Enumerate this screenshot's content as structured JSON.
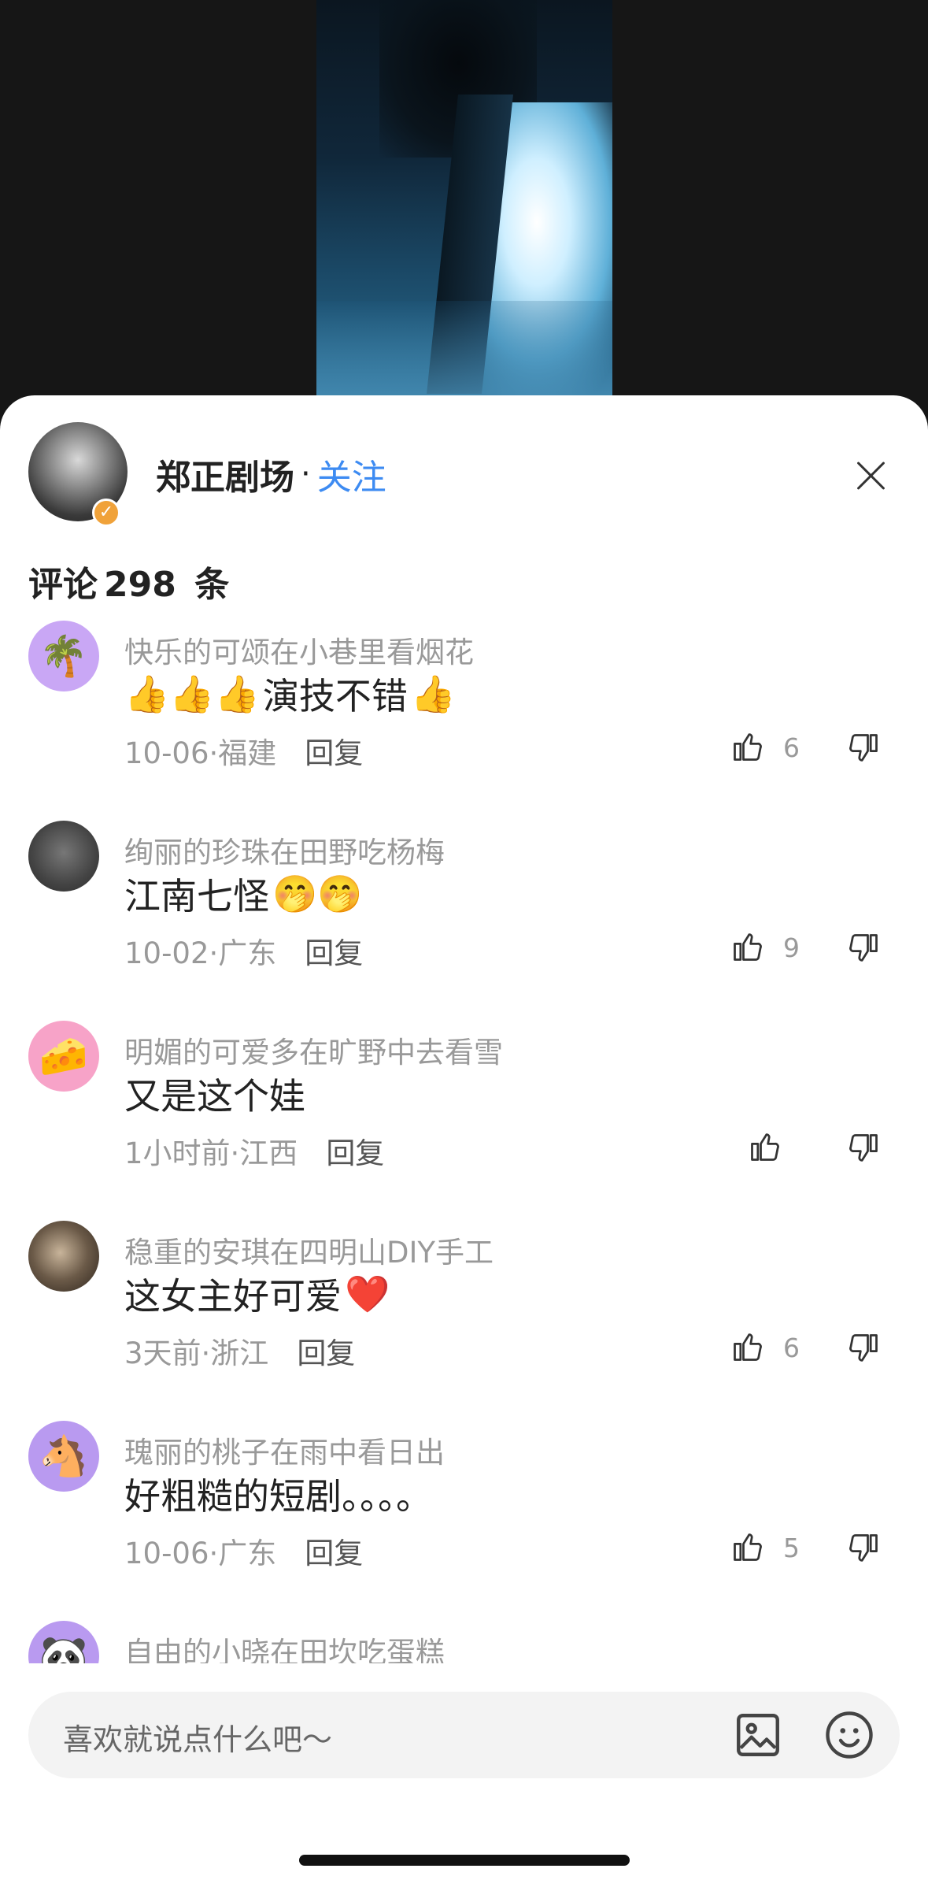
{
  "author": {
    "name": "郑正剧场",
    "separator": "·",
    "follow_label": "关注",
    "verified_mark": "✓"
  },
  "comments_header": {
    "label": "评论",
    "count": "298",
    "unit": "条"
  },
  "comments": [
    {
      "user": "快乐的可颂在小巷里看烟花",
      "avatar_emoji": "🌴",
      "text_prefix": "👍👍👍",
      "text": "演技不错",
      "text_suffix": "👍",
      "meta": "10-06·福建",
      "reply_label": "回复",
      "likes": "6"
    },
    {
      "user": "绚丽的珍珠在田野吃杨梅",
      "avatar_emoji": "",
      "text_prefix": "",
      "text": "江南七怪",
      "text_suffix": "🤭🤭",
      "meta": "10-02·广东",
      "reply_label": "回复",
      "likes": "9"
    },
    {
      "user": "明媚的可爱多在旷野中去看雪",
      "avatar_emoji": "🧀",
      "text_prefix": "",
      "text": "又是这个娃",
      "text_suffix": "",
      "meta": "1小时前·江西",
      "reply_label": "回复",
      "likes": ""
    },
    {
      "user": "稳重的安琪在四明山DIY手工",
      "avatar_emoji": "",
      "text_prefix": "",
      "text": "这女主好可爱",
      "text_suffix": "❤️",
      "meta": "3天前·浙江",
      "reply_label": "回复",
      "likes": "6"
    },
    {
      "user": "瑰丽的桃子在雨中看日出",
      "avatar_emoji": "🐴",
      "text_prefix": "",
      "text": "好粗糙的短剧。。。。",
      "text_suffix": "",
      "meta": "10-06·广东",
      "reply_label": "回复",
      "likes": "5"
    },
    {
      "user": "自由的小晓在田坎吃蛋糕",
      "avatar_emoji": "🐼",
      "text_prefix": "",
      "text": "",
      "text_suffix": "",
      "meta": "",
      "reply_label": "",
      "likes": ""
    }
  ],
  "input": {
    "placeholder": "喜欢就说点什么吧～"
  },
  "icons": {
    "like": "thumbs-up-icon",
    "dislike": "thumbs-down-icon",
    "image": "image-icon",
    "emoji": "smile-icon",
    "close": "close-icon"
  },
  "colors": {
    "accent": "#3d8bf2",
    "badge": "#f0a23a"
  }
}
